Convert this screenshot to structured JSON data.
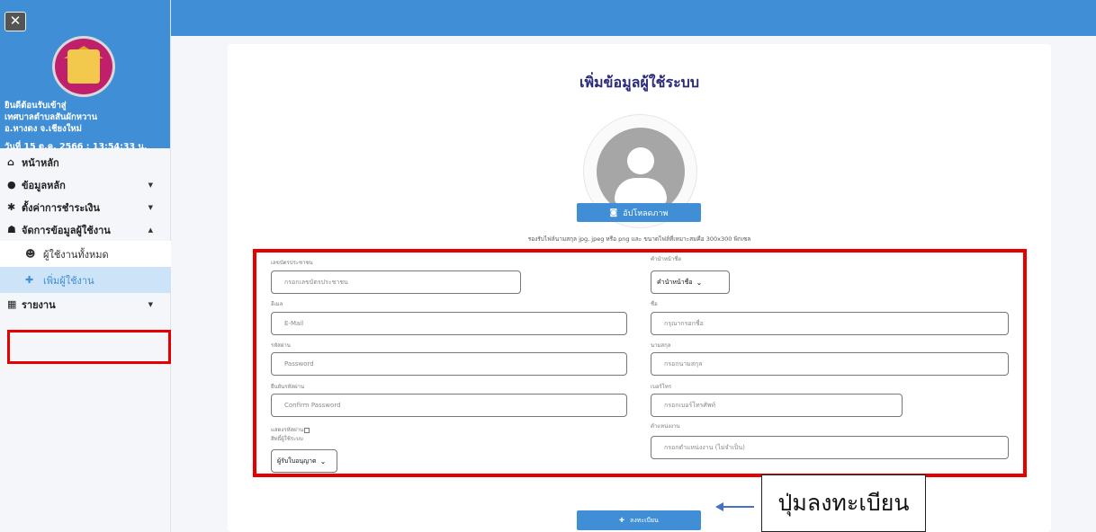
{
  "sidebar": {
    "welcome_line1": "ยินดีต้อนรับเข้าสู่",
    "welcome_line2": "เทศบาลตำบลสันผักหวาน",
    "welcome_line3": "อ.หางดง จ.เชียงใหม่",
    "datetime": "วันที่ 15 ต.ค. 2566 : 13:54:33 น.",
    "menu": {
      "home": "หน้าหลัก",
      "master_data": "ข้อมูลหลัก",
      "payment_settings": "ตั้งค่าการชำระเงิน",
      "user_management": "จัดการข้อมูลผู้ใช้งาน",
      "all_users": "ผู้ใช้งานทั้งหมด",
      "add_user": "เพิ่มผู้ใช้งาน",
      "report": "รายงาน"
    }
  },
  "page": {
    "title": "เพิ่มข้อมูลผู้ใช้ระบบ",
    "upload_label": "อัปโหลดภาพ",
    "upload_hint": "รองรับไฟล์นามสกุล jpg, jpeg หรือ png และ ขนาดไฟล์ที่เหมาะสมคือ 300x300 พิกเซล",
    "register_label": "ลงทะเบียน"
  },
  "form": {
    "id_card_label": "เลขบัตรประชาชน",
    "id_card_placeholder": "กรอกเลขบัตรประชาชน",
    "prefix_label": "คำนำหน้าชื่อ",
    "prefix_value": "คำนำหน้าชื่อ",
    "email_label": "อีเมล",
    "email_placeholder": "E-Mail",
    "firstname_label": "ชื่อ",
    "firstname_placeholder": "กรุณากรอกชื่อ",
    "password_label": "รหัสผ่าน",
    "password_placeholder": "Password",
    "lastname_label": "นามสกุล",
    "lastname_placeholder": "กรอกนามสกุล",
    "confirm_label": "ยืนยันรหัสผ่าน",
    "confirm_placeholder": "Confirm Password",
    "phone_label": "เบอร์โทร",
    "phone_placeholder": "กรอกเบอร์โทรศัพท์",
    "show_password_label": "แสดงรหัสผ่าน",
    "role_label": "สิทธิ์ผู้ใช้ระบบ",
    "role_value": "ผู้รับใบอนุญาต",
    "position_label": "ตำแหน่งงาน",
    "position_placeholder": "กรอกตำแหน่งงาน (ไม่จำเป็น)"
  },
  "annotation": {
    "callout_text": "ปุ่มลงทะเบียน"
  },
  "colors": {
    "primary": "#3f8ed6",
    "highlight": "#e60000",
    "title": "#2a2a7a"
  }
}
